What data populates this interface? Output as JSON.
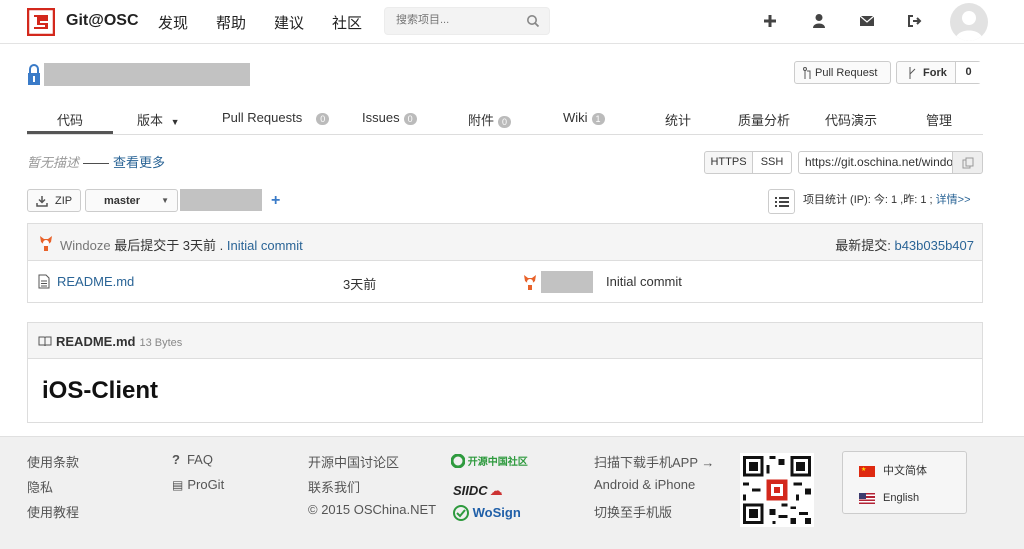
{
  "header": {
    "brand": "Git@OSC",
    "nav": [
      "发现",
      "帮助",
      "建议",
      "社区"
    ],
    "search_placeholder": "搜索项目..."
  },
  "project": {
    "pull_request_label": "Pull Request",
    "fork_label": "Fork",
    "fork_count": "0"
  },
  "tabs": [
    {
      "label": "代码",
      "badge": ""
    },
    {
      "label": "版本",
      "badge": ""
    },
    {
      "label": "Pull Requests",
      "badge": "0"
    },
    {
      "label": "Issues",
      "badge": "0"
    },
    {
      "label": "附件",
      "badge": "0"
    },
    {
      "label": "Wiki",
      "badge": "1"
    },
    {
      "label": "统计",
      "badge": ""
    },
    {
      "label": "质量分析",
      "badge": ""
    },
    {
      "label": "代码演示",
      "badge": ""
    },
    {
      "label": "管理",
      "badge": ""
    }
  ],
  "description": {
    "text": "暂无描述",
    "dash": "——",
    "more": "查看更多"
  },
  "clone": {
    "https": "HTTPS",
    "ssh": "SSH",
    "url": "https://git.oschina.net/windoze/iOS-Client.git"
  },
  "branch": {
    "zip": "ZIP",
    "name": "master",
    "stats_prefix": "项目统计 (IP): 今: 1 ,昨: 1 ;",
    "stats_link": "详情>>"
  },
  "commit": {
    "author": "Windoze",
    "text": " 最后提交于 3天前 . ",
    "message": "Initial commit",
    "latest_label": "最新提交: ",
    "hash": "b43b035b407"
  },
  "files": [
    {
      "name": "README.md",
      "time": "3天前",
      "message": "Initial commit"
    }
  ],
  "readme": {
    "title": "README.md",
    "size": "13 Bytes",
    "heading": "iOS-Client"
  },
  "footer": {
    "col1": [
      "使用条款",
      "隐私",
      "使用教程"
    ],
    "col2": [
      "FAQ",
      "ProGit"
    ],
    "col3": [
      "开源中国讨论区",
      "联系我们",
      "© 2015 OSChina.NET"
    ],
    "col4": [
      "扫描下载手机APP →",
      "Android & iPhone",
      "切换至手机版"
    ],
    "sponsors": [
      "开源中国社区",
      "SIIDC",
      "WoSign"
    ],
    "languages": [
      "中文简体",
      "English"
    ]
  },
  "colors": {
    "brand_red": "#d3281c",
    "link": "#2a6496"
  }
}
